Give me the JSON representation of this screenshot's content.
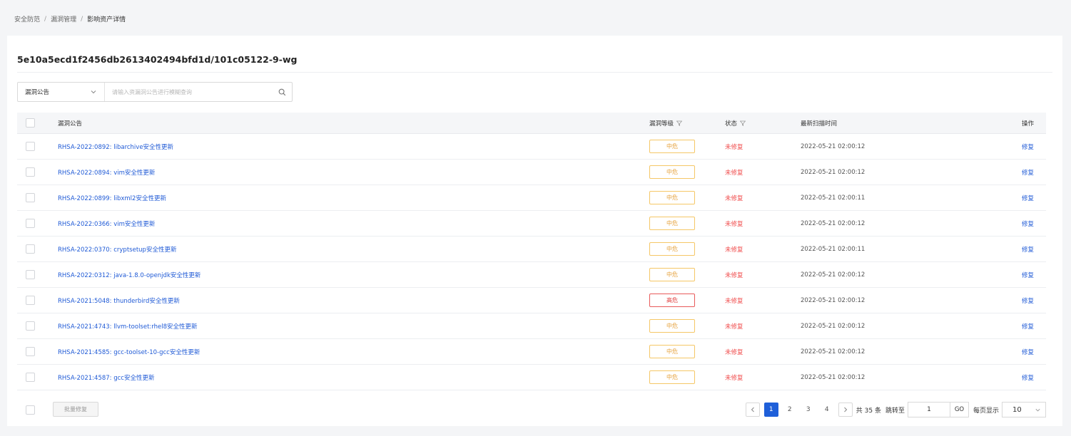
{
  "breadcrumb": [
    "安全防范",
    "漏洞管理",
    "影响资产详情"
  ],
  "page_title": "5e10a5ecd1f2456db2613402494bfd1d/101c05122-9-wg",
  "filter": {
    "select_value": "漏洞公告",
    "search_placeholder": "请输入资漏洞公告进行模糊查询"
  },
  "table": {
    "headers": {
      "name": "漏洞公告",
      "level": "漏洞等级",
      "status": "状态",
      "time": "最新扫描时间",
      "op": "操作"
    },
    "rows": [
      {
        "name": "RHSA-2022:0892: libarchive安全性更新",
        "level": "中危",
        "level_type": "medium",
        "status": "未修复",
        "time": "2022-05-21 02:00:12",
        "op": "修复"
      },
      {
        "name": "RHSA-2022:0894: vim安全性更新",
        "level": "中危",
        "level_type": "medium",
        "status": "未修复",
        "time": "2022-05-21 02:00:12",
        "op": "修复"
      },
      {
        "name": "RHSA-2022:0899: libxml2安全性更新",
        "level": "中危",
        "level_type": "medium",
        "status": "未修复",
        "time": "2022-05-21 02:00:11",
        "op": "修复"
      },
      {
        "name": "RHSA-2022:0366: vim安全性更新",
        "level": "中危",
        "level_type": "medium",
        "status": "未修复",
        "time": "2022-05-21 02:00:12",
        "op": "修复"
      },
      {
        "name": "RHSA-2022:0370: cryptsetup安全性更新",
        "level": "中危",
        "level_type": "medium",
        "status": "未修复",
        "time": "2022-05-21 02:00:11",
        "op": "修复"
      },
      {
        "name": "RHSA-2022:0312: java-1.8.0-openjdk安全性更新",
        "level": "中危",
        "level_type": "medium",
        "status": "未修复",
        "time": "2022-05-21 02:00:12",
        "op": "修复"
      },
      {
        "name": "RHSA-2021:5048: thunderbird安全性更新",
        "level": "高危",
        "level_type": "high",
        "status": "未修复",
        "time": "2022-05-21 02:00:12",
        "op": "修复"
      },
      {
        "name": "RHSA-2021:4743: llvm-toolset:rhel8安全性更新",
        "level": "中危",
        "level_type": "medium",
        "status": "未修复",
        "time": "2022-05-21 02:00:12",
        "op": "修复"
      },
      {
        "name": "RHSA-2021:4585: gcc-toolset-10-gcc安全性更新",
        "level": "中危",
        "level_type": "medium",
        "status": "未修复",
        "time": "2022-05-21 02:00:12",
        "op": "修复"
      },
      {
        "name": "RHSA-2021:4587: gcc安全性更新",
        "level": "中危",
        "level_type": "medium",
        "status": "未修复",
        "time": "2022-05-21 02:00:12",
        "op": "修复"
      }
    ]
  },
  "footer": {
    "batch_label": "批量修复",
    "pages": [
      "1",
      "2",
      "3",
      "4"
    ],
    "current_page": "1",
    "total_text": "共 35 条",
    "jump_label": "跳转至",
    "jump_value": "1",
    "go_label": "GO",
    "page_size_label": "每页显示",
    "page_size": "10"
  },
  "colors": {
    "link": "#1f5ad6",
    "medium": "#e6a23c",
    "high": "#e03c3c",
    "status_unfixed": "#f04b4b",
    "pager_active": "#1e5fd9"
  },
  "icons": {
    "select_chevron": "chevron-down-icon",
    "search": "search-icon",
    "column_filter": "filter-icon",
    "prev": "chevron-left-icon",
    "next": "chevron-right-icon"
  }
}
